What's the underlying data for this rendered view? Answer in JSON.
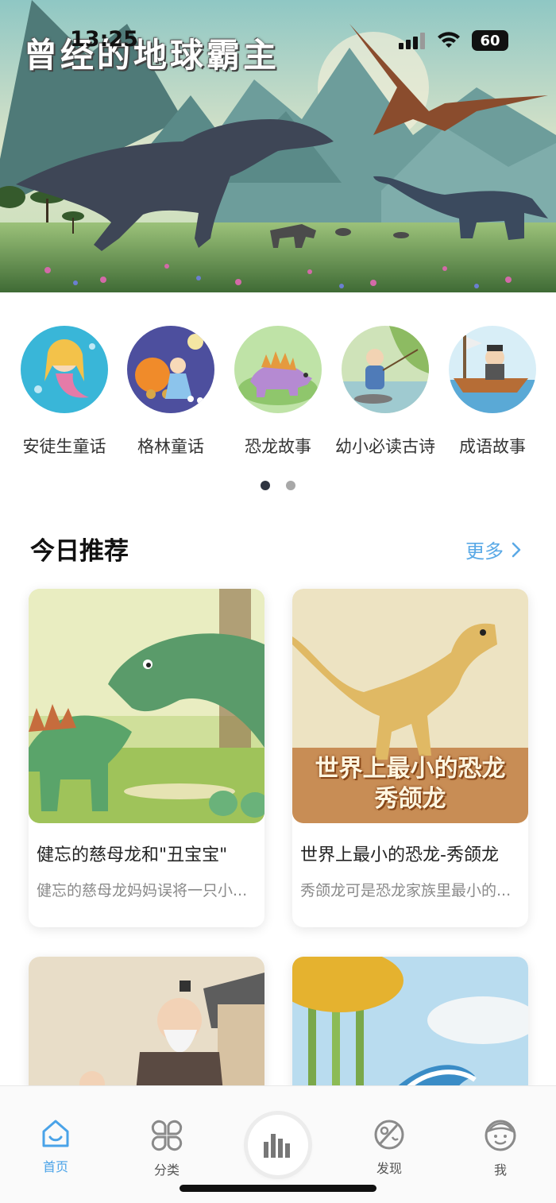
{
  "status": {
    "time": "13:25",
    "battery": "60"
  },
  "hero": {
    "title": "曾经的地球霸主"
  },
  "categories": [
    {
      "label": "安徒生童话",
      "icon": "mermaid-image"
    },
    {
      "label": "格林童话",
      "icon": "cinderella-carriage-image"
    },
    {
      "label": "恐龙故事",
      "icon": "stegosaurus-image"
    },
    {
      "label": "幼小必读古诗",
      "icon": "fishing-boy-image"
    },
    {
      "label": "成语故事",
      "icon": "boat-man-image"
    }
  ],
  "section": {
    "title": "今日推荐",
    "more": "更多"
  },
  "cards": [
    {
      "title": "健忘的慈母龙和\"丑宝宝\"",
      "desc": "健忘的慈母龙妈妈误将一只小..."
    },
    {
      "title": "世界上最小的恐龙-秀颌龙",
      "desc": "秀颌龙可是恐龙家族里最小的...",
      "overlay": [
        "世界上最小的恐龙",
        "秀颌龙"
      ]
    },
    {
      "title": "",
      "desc": ""
    },
    {
      "title": "",
      "desc": ""
    }
  ],
  "tabs": [
    {
      "label": "首页",
      "icon": "home-icon"
    },
    {
      "label": "分类",
      "icon": "category-icon"
    },
    {
      "label": "",
      "icon": "audio-bars-icon"
    },
    {
      "label": "发现",
      "icon": "discover-icon"
    },
    {
      "label": "我",
      "icon": "profile-icon"
    }
  ],
  "colors": {
    "accent": "#4aa3e8",
    "more": "#5aa9e6",
    "title": "#111111",
    "muted": "#8a8a8a"
  }
}
